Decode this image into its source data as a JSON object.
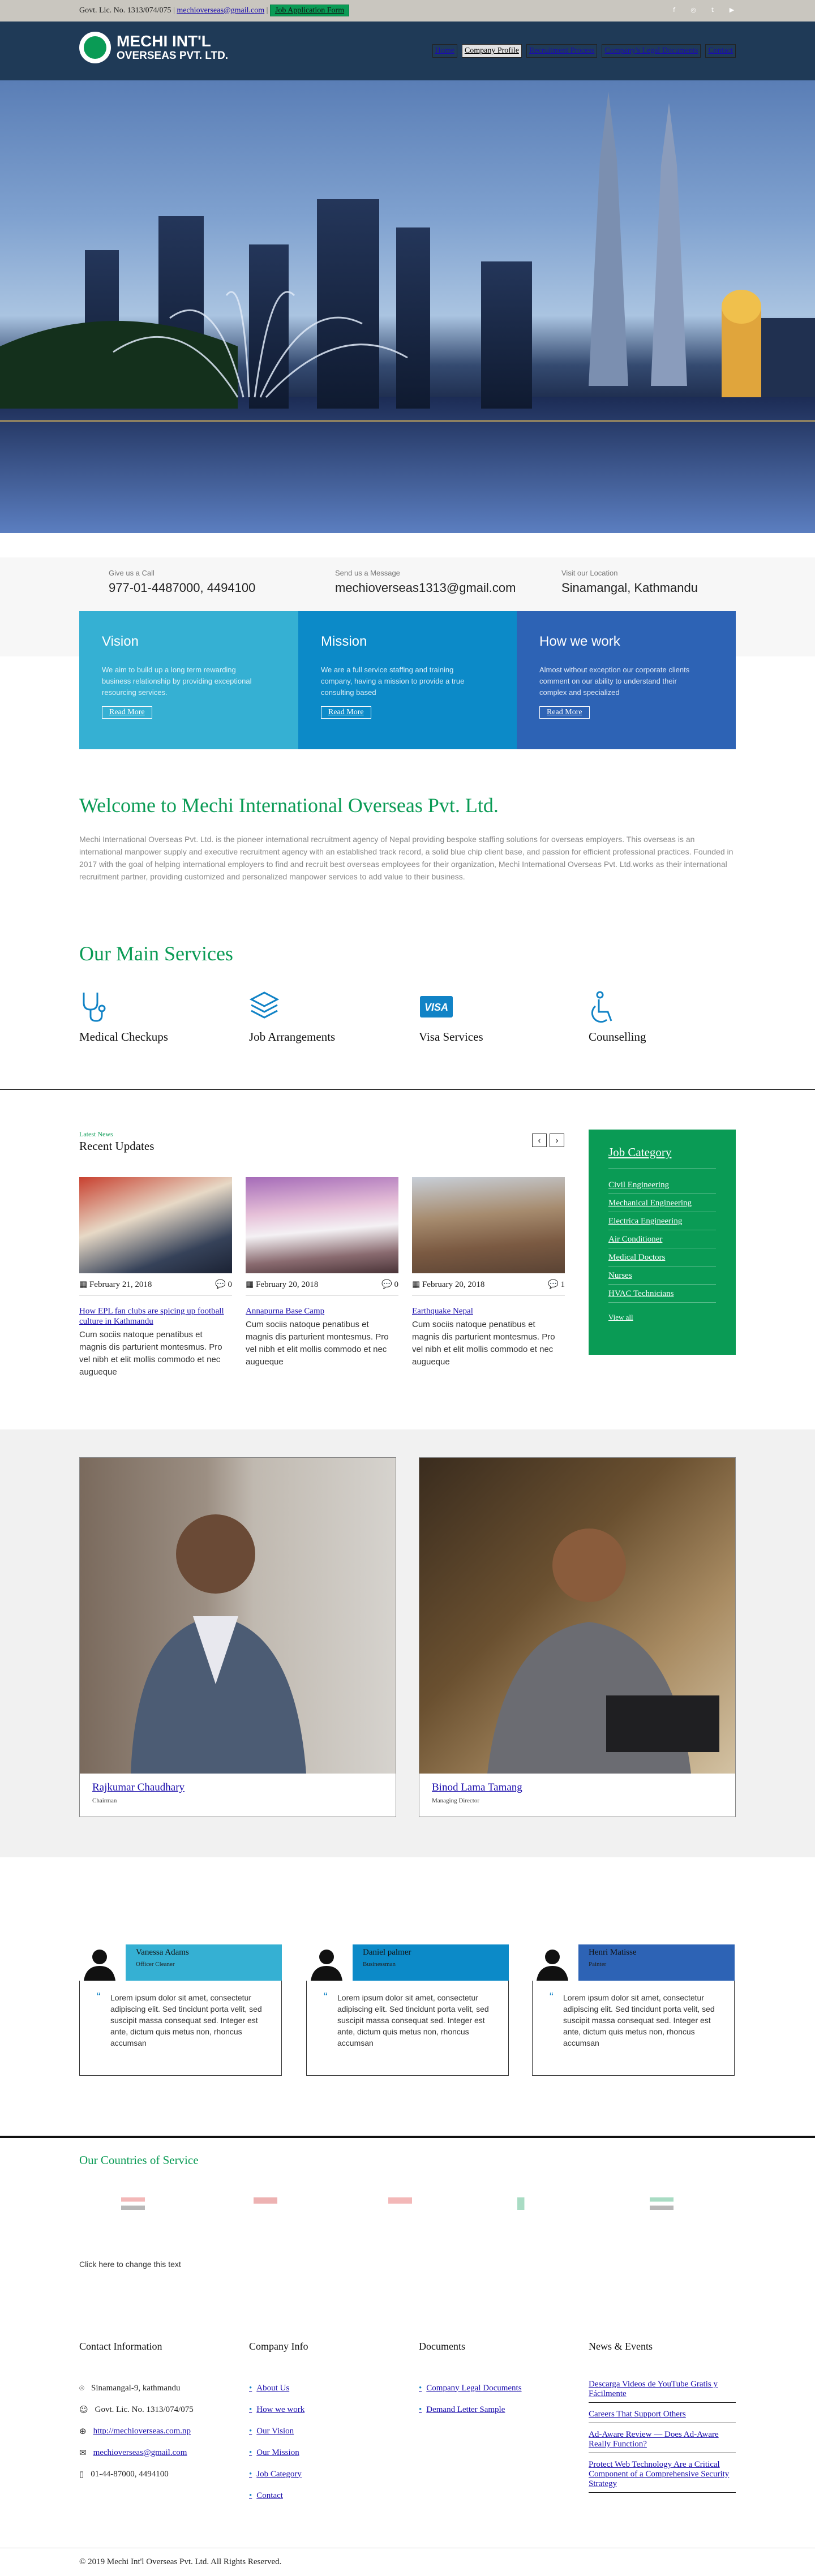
{
  "topbar": {
    "license": "Govt. Lic. No. 1313/074/075",
    "separator": "|",
    "email": "mechioverseas@gmail.com",
    "job_button": "Job Application Form",
    "social": [
      "f",
      "ig",
      "t",
      "yt"
    ]
  },
  "brand": {
    "line1": "MECHI INT'L",
    "line2": "OVERSEAS PVT. LTD."
  },
  "nav": [
    {
      "label": "Home"
    },
    {
      "label": "Company Profile"
    },
    {
      "label": "Recruitment Process"
    },
    {
      "label": "Company's Legal Documents"
    },
    {
      "label": "Contact"
    }
  ],
  "info": [
    {
      "label": "Give us a Call",
      "value": "977-01-4487000, 4494100"
    },
    {
      "label": "Send us a Message",
      "value": "mechioverseas1313@gmail.com"
    },
    {
      "label": "Visit our Location",
      "value": "Sinamangal, Kathmandu"
    }
  ],
  "cards": [
    {
      "title": "Vision",
      "text": "We aim to build up a long term rewarding business relationship by providing exceptional resourcing services.",
      "button": "Read More",
      "color": "#35b0d3"
    },
    {
      "title": "Mission",
      "text": "We are a full service staffing and training company, having a mission to provide a true consulting based",
      "button": "Read More",
      "color": "#0c8ac8"
    },
    {
      "title": "How we work",
      "text": "Almost without exception our corporate clients comment on our ability to understand their complex and specialized",
      "button": "Read More",
      "color": "#2d63b5"
    }
  ],
  "welcome": {
    "title": "Welcome to Mechi International Overseas Pvt. Ltd.",
    "text": "Mechi International Overseas Pvt. Ltd. is the pioneer international recruitment agency of Nepal providing bespoke staffing solutions for overseas employers. This overseas is an international manpower supply and executive recruitment agency with an established track record, a solid blue chip client base, and passion for efficient professional practices. Founded in 2017 with the goal of helping international employers to find and recruit best overseas employees for their organization, Mechi International Overseas Pvt. Ltd.works as their international recruitment partner, providing customized and personalized manpower services to add value to their business."
  },
  "services": {
    "title": "Our Main Services",
    "items": [
      {
        "label": "Medical Checkups",
        "icon": "stethoscope-icon"
      },
      {
        "label": "Job Arrangements",
        "icon": "layers-icon"
      },
      {
        "label": "Visa Services",
        "icon": "visa-card-icon"
      },
      {
        "label": "Counselling",
        "icon": "wheelchair-icon"
      }
    ]
  },
  "updates": {
    "kicker": "Latest News",
    "title": "Recent Updates",
    "prev": "‹",
    "next": "›",
    "posts": [
      {
        "date": "February 21, 2018",
        "comments": "0",
        "title": "How EPL fan clubs are spicing up football culture in Kathmandu",
        "excerpt": "Cum sociis natoque penatibus et magnis dis parturient montesmus. Pro vel nibh et elit mollis commodo et nec augueque"
      },
      {
        "date": "February 20, 2018",
        "comments": "0",
        "title": "Annapurna Base Camp",
        "excerpt": "Cum sociis natoque penatibus et magnis dis parturient montesmus. Pro vel nibh et elit mollis commodo et nec augueque"
      },
      {
        "date": "February 20, 2018",
        "comments": "1",
        "title": "Earthquake Nepal",
        "excerpt": "Cum sociis natoque penatibus et magnis dis parturient montesmus. Pro vel nibh et elit mollis commodo et nec augueque"
      }
    ]
  },
  "job_category": {
    "title": "Job Category",
    "items": [
      "Civil Engineering",
      "Mechanical Engineering",
      "Electrica Engineering",
      "Air Conditioner",
      "Medical Doctors",
      "Nurses",
      "HVAC Technicians"
    ],
    "view_all": "View all"
  },
  "team": [
    {
      "name": "Rajkumar Chaudhary",
      "role": "Chairman"
    },
    {
      "name": "Binod Lama Tamang",
      "role": "Managing Director"
    }
  ],
  "testimonials": [
    {
      "name": "Vanessa Adams",
      "role": "Officer Cleaner",
      "text": "Lorem ipsum dolor sit amet, consectetur adipiscing elit. Sed tincidunt porta velit, sed suscipit massa consequat sed. Integer est ante, dictum quis metus non, rhoncus accumsan",
      "color": "#35b0d3"
    },
    {
      "name": "Daniel palmer",
      "role": "Businessman",
      "text": "Lorem ipsum dolor sit amet, consectetur adipiscing elit. Sed tincidunt porta velit, sed suscipit massa consequat sed. Integer est ante, dictum quis metus non, rhoncus accumsan",
      "color": "#0c8ac8"
    },
    {
      "name": "Henri Matisse",
      "role": "Painter",
      "text": "Lorem ipsum dolor sit amet, consectetur adipiscing elit. Sed tincidunt porta velit, sed suscipit massa consequat sed. Integer est ante, dictum quis metus non, rhoncus accumsan",
      "color": "#2d63b5"
    }
  ],
  "countries": {
    "title": "Our Countries of Service",
    "change_text": "Click here to change this text"
  },
  "footer": {
    "contact": {
      "title": "Contact Information",
      "address": "Sinamangal-9, kathmandu",
      "license": "Govt. Lic. No. 1313/074/075",
      "website": "http://mechioverseas.com.np",
      "email": "mechioverseas@gmail.com",
      "phone": "01-44-87000, 4494100"
    },
    "company": {
      "title": "Company Info",
      "links": [
        "About Us",
        "How we work",
        "Our Vision",
        "Our Mission",
        "Job Category",
        "Contact"
      ]
    },
    "documents": {
      "title": "Documents",
      "links": [
        "Company Legal Documents",
        "Demand Letter Sample"
      ]
    },
    "news": {
      "title": "News & Events",
      "links": [
        "Descarga Videos de YouTube Gratis y Fácilmente",
        "Careers That Support Others",
        "Ad-Aware Review — Does Ad-Aware Really Function?",
        "Protect Web Technology Are a Critical Component of a Comprehensive Security Strategy"
      ]
    }
  },
  "copyright": "© 2019 Mechi Int'l Overseas Pvt. Ltd. All Rights Reserved."
}
